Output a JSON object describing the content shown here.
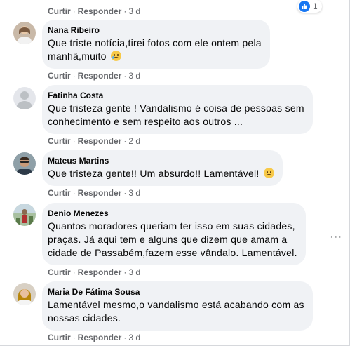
{
  "top_actions": {
    "like": "Curtir",
    "reply": "Responder",
    "time": "3 d",
    "reaction_count": "1"
  },
  "comments": [
    {
      "author": "Nana Ribeiro",
      "lines": [
        "Que triste notícia,tirei fotos com ele ontem pela",
        "manhã,muito"
      ],
      "emoji": "sad-tear-emoji",
      "like": "Curtir",
      "reply": "Responder",
      "time": "3 d"
    },
    {
      "author": "Fatinha Costa",
      "lines": [
        "Que tristeza gente ! Vandalismo é coisa de pessoas sem",
        "conhecimento e sem respeito aos outros ..."
      ],
      "like": "Curtir",
      "reply": "Responder",
      "time": "2 d"
    },
    {
      "author": "Mateus Martins",
      "lines": [
        "Que tristeza gente!! Um absurdo!! Lamentável!"
      ],
      "emoji": "frown-emoji",
      "like": "Curtir",
      "reply": "Responder",
      "time": "3 d"
    },
    {
      "author": "Denio Menezes",
      "lines": [
        "Quantos moradores queriam ter isso em suas cidades,",
        "praças. Já aqui tem e alguns que dizem que amam a",
        "cidade de Passabém,fazem esse vândalo. Lamentável."
      ],
      "like": "Curtir",
      "reply": "Responder",
      "time": "3 d"
    },
    {
      "author": "Maria De Fátima Sousa",
      "lines": [
        "Lamentável mesmo,o vandalismo está acabando com as",
        "nossas cidades."
      ],
      "like": "Curtir",
      "reply": "Responder",
      "time": "3 d"
    }
  ],
  "more_options": "···",
  "colors": {
    "bubble": "#f0f2f5",
    "meta": "#65676b",
    "like": "#1877f2"
  }
}
